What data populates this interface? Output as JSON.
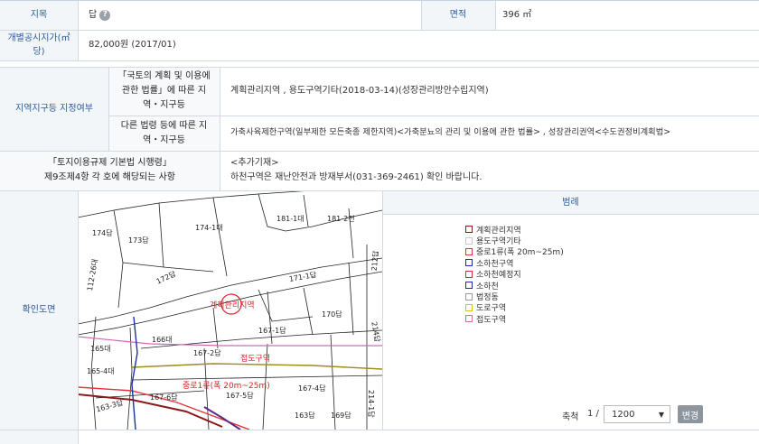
{
  "row1": {
    "label_jimok": "지목",
    "jimok_value": "답",
    "label_area": "면적",
    "area_value": "396 ㎡"
  },
  "row2": {
    "label_price": "개별공시지가(㎡당)",
    "price_value": "82,000원 (2017/01)"
  },
  "zoning": {
    "main_label": "지역지구등 지정여부",
    "sub1_label": "「국토의 계획 및 이용에 관한 법률」에 따른 지역・지구등",
    "sub1_value": "계획관리지역 , 용도구역기타(2018-03-14)(성장관리방안수립지역)",
    "sub2_label": "다른 법령 등에 따른 지역・지구등",
    "sub2_value": "가축사육제한구역(일부제한 모든축종 제한지역)<가축분뇨의 관리 및 이용에 관한 법률> , 성장관리권역<수도권정비계획법>"
  },
  "regulation": {
    "label_line1": "「토지이용규제 기본법 시행령」",
    "label_line2": "제9조제4항 각 호에 해당되는 사항",
    "value_line1": "<추가기재>",
    "value_line2": "하천구역은 재난안전과 방재부서(031-369-2461) 확인 바랍니다."
  },
  "map": {
    "label": "확인도면",
    "parcels": [
      "174답",
      "173답",
      "174-1대",
      "181-1대",
      "181-2전",
      "112-26대",
      "172답",
      "171-1답",
      "212답",
      "계획관리지역",
      "170답",
      "214답",
      "166대",
      "167-1답",
      "165대",
      "167-2답",
      "165-4대",
      "167-4답",
      "167-6답",
      "167-5답",
      "214-1답",
      "163-3답",
      "163답",
      "169답"
    ],
    "overlays": {
      "road_zone": "접도구역",
      "road_class": "중로1류(폭 20m~25m)"
    }
  },
  "legend": {
    "title": "범례",
    "items": [
      {
        "label": "계획관리지역",
        "color": "#8b1a1a"
      },
      {
        "label": "용도구역기타",
        "color": "#c8c8c8"
      },
      {
        "label": "중로1류(폭 20m~25m)",
        "color": "#e2343a"
      },
      {
        "label": "소하천구역",
        "color": "#1a2fa8"
      },
      {
        "label": "소하천예정지",
        "color": "#c8324a"
      },
      {
        "label": "소하천",
        "color": "#1a2fa8"
      },
      {
        "label": "법정동",
        "color": "#9a9a9a"
      },
      {
        "label": "도로구역",
        "color": "#d6c21a"
      },
      {
        "label": "접도구역",
        "color": "#d36ab0"
      }
    ]
  },
  "scale": {
    "label": "축척",
    "prefix": "1 /",
    "value": "1200",
    "change_button": "변경"
  }
}
